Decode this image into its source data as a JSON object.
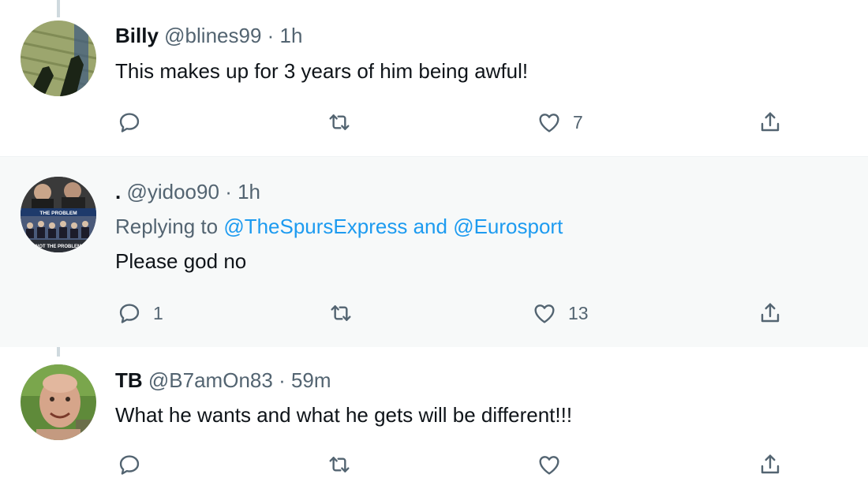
{
  "tweets": [
    {
      "name": "Billy",
      "handle": "@blines99",
      "dot": "·",
      "time": "1h",
      "text": "This makes up for 3 years of him being awful!",
      "reply_count": "",
      "retweet_count": "",
      "like_count": "7"
    },
    {
      "name": ".",
      "handle": "@yidoo90",
      "dot": "·",
      "time": "1h",
      "replying_prefix": "Replying to ",
      "replying_user1": "@TheSpursExpress",
      "replying_and": " and ",
      "replying_user2": "@Eurosport",
      "text": "Please god no",
      "reply_count": "1",
      "retweet_count": "",
      "like_count": "13",
      "avatar_text_top": "THE PROBLEM",
      "avatar_text_bottom": "NOT THE PROBLEM"
    },
    {
      "name": "TB",
      "handle": "@B7amOn83",
      "dot": "·",
      "time": "59m",
      "text": "What he wants and what he gets will be different!!!"
    }
  ],
  "icons": {
    "reply": "reply-icon",
    "retweet": "retweet-icon",
    "like": "heart-icon",
    "share": "share-icon"
  },
  "colors": {
    "muted": "#536471",
    "link": "#1d9bf0",
    "highlight_bg": "#f7f9f9",
    "thread_line": "#cfd9de"
  }
}
